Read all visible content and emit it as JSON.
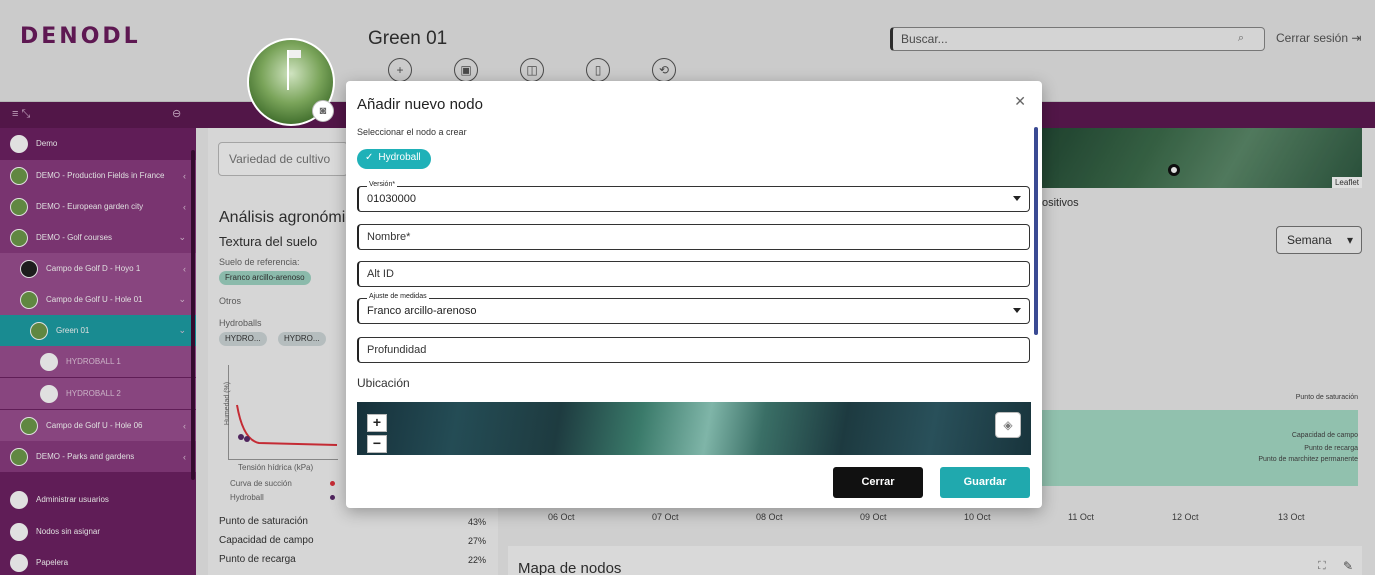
{
  "header": {
    "logo": "DENODL",
    "page_title": "Green 01",
    "search_placeholder": "Buscar...",
    "logout": "Cerrar sesión",
    "toolbar": [
      "+",
      "▣",
      "◫",
      "▯",
      "⟲"
    ]
  },
  "sidebar": {
    "items": [
      {
        "label": "Demo",
        "level": 0
      },
      {
        "label": "DEMO - Production Fields in France",
        "level": 1
      },
      {
        "label": "DEMO - European garden city",
        "level": 1
      },
      {
        "label": "DEMO - Golf courses",
        "level": 1
      },
      {
        "label": "Campo de Golf D - Hoyo 1",
        "level": 2
      },
      {
        "label": "Campo de Golf U - Hole 01",
        "level": 2
      },
      {
        "label": "Green 01",
        "level": 3,
        "active": true
      },
      {
        "label": "HYDROBALL 1",
        "level": 4
      },
      {
        "label": "HYDROBALL 2",
        "level": 4
      },
      {
        "label": "Campo de Golf U - Hole 06",
        "level": 2
      },
      {
        "label": "DEMO - Parks and gardens",
        "level": 1
      },
      {
        "label": "Administrar usuarios",
        "level": 0
      },
      {
        "label": "Nodos sin asignar",
        "level": 0
      },
      {
        "label": "Papelera",
        "level": 0
      }
    ]
  },
  "background": {
    "crop_variety": "Variedad de cultivo",
    "agro_title": "Análisis agronómic",
    "soil_texture": "Textura del suelo",
    "ref_soil_label": "Suelo de referencia:",
    "ref_soil_chip": "Franco arcillo-arenoso",
    "others": "Otros",
    "hydroballs": "Hydroballs",
    "hydro_chips": [
      "HYDRO...",
      "HYDRO..."
    ],
    "chart_ylabel": "Humedad (%)",
    "chart_xlabel": "Tensión hídrica (kPa)",
    "legend": [
      {
        "label": "Curva de succión",
        "color": "#e0323c"
      },
      {
        "label": "Hydroball",
        "color": "#5a2a6a"
      }
    ],
    "stats": [
      {
        "label": "Punto de saturación",
        "value": "43%"
      },
      {
        "label": "Capacidad de campo",
        "value": "27%"
      },
      {
        "label": "Punto de recarga",
        "value": "22%"
      }
    ],
    "leaflet": "Leaflet",
    "devices_fragment": "ositivos",
    "period": "Semana",
    "chart_lines": [
      "Punto de saturación",
      "Capacidad de campo",
      "Punto de recarga",
      "Punto de marchitez permanente"
    ],
    "x_ticks": [
      "06 Oct",
      "07 Oct",
      "08 Oct",
      "09 Oct",
      "10 Oct",
      "11 Oct",
      "12 Oct",
      "13 Oct"
    ],
    "map_nodes_title": "Mapa de nodos"
  },
  "modal": {
    "title": "Añadir nuevo nodo",
    "subtitle": "Seleccionar el nodo a crear",
    "node_type": "Hydroball",
    "version_label": "Versión*",
    "version_value": "01030000",
    "name_placeholder": "Nombre*",
    "altid_placeholder": "Alt ID",
    "measure_label": "Ajuste de medidas",
    "measure_value": "Franco arcillo-arenoso",
    "depth_placeholder": "Profundidad",
    "location_title": "Ubicación",
    "zoom_in": "+",
    "zoom_out": "−",
    "close_label": "Cerrar",
    "save_label": "Guardar"
  }
}
